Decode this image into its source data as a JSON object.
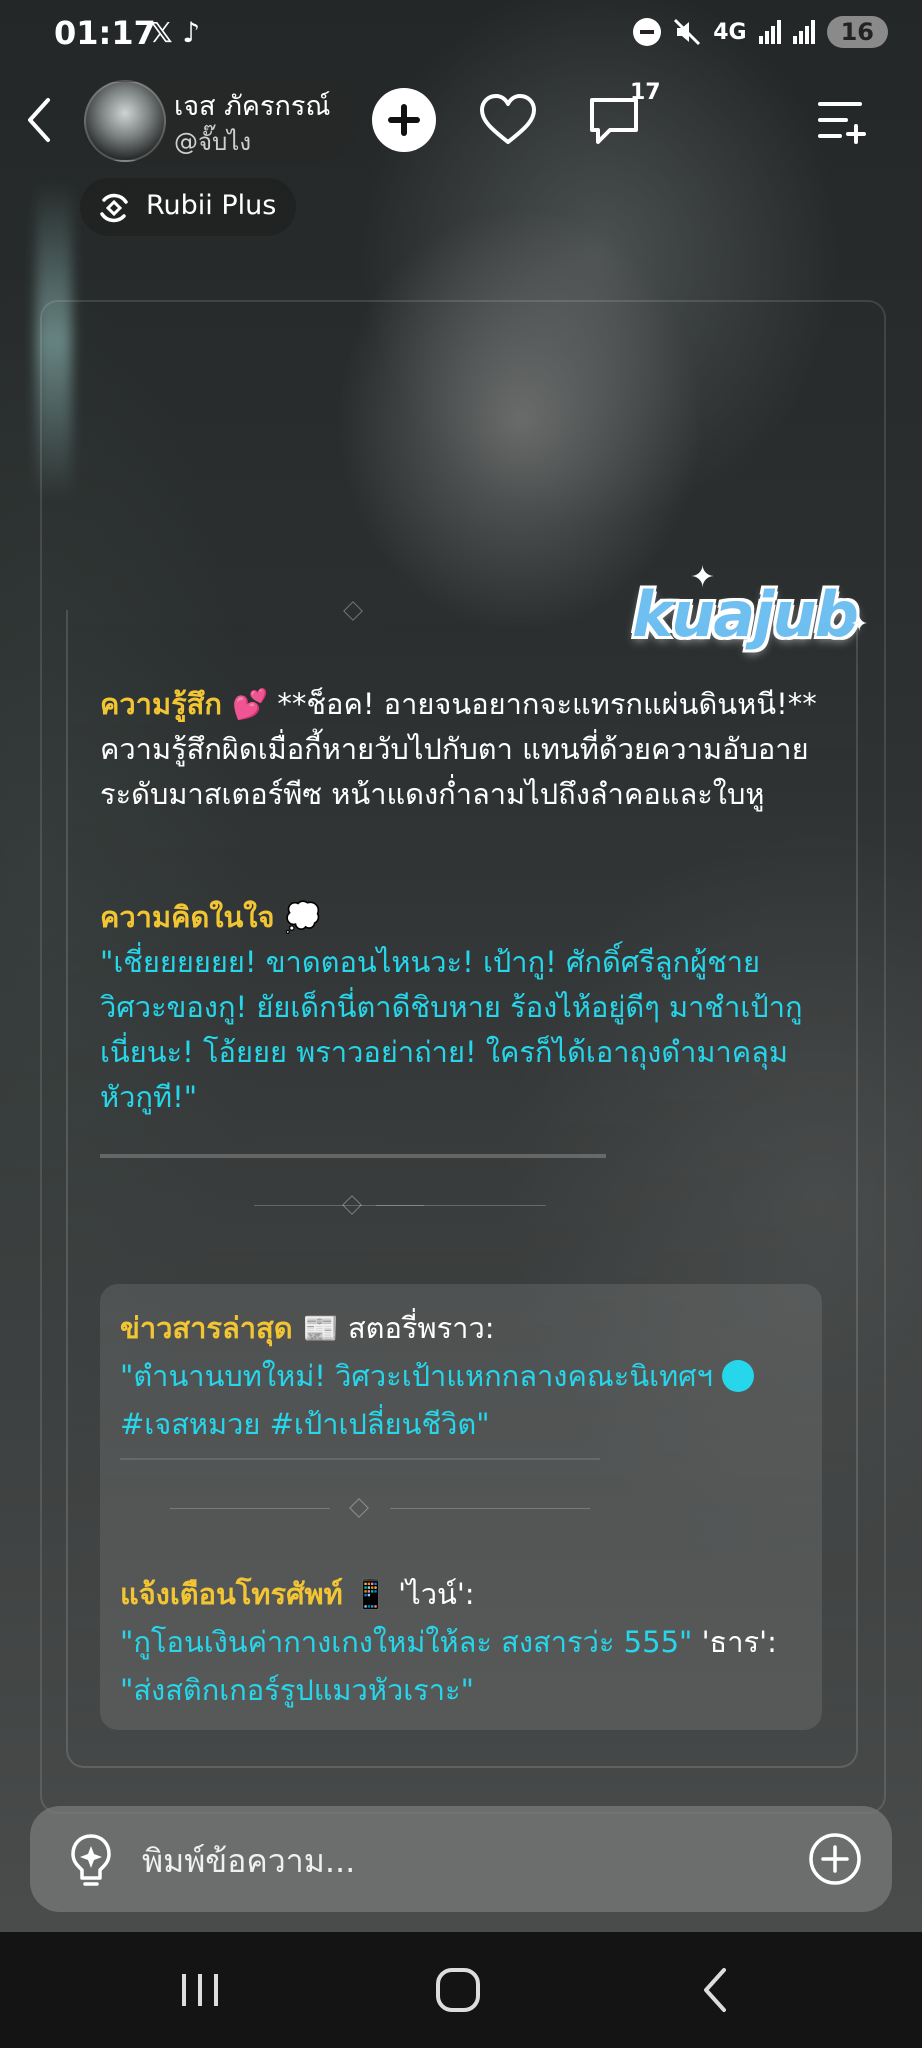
{
  "status_bar": {
    "time": "01:17",
    "app_icons": "𝕏 ♪",
    "network": "4G",
    "battery": "16"
  },
  "header": {
    "profile_name": "เจส ภัครกรณ์",
    "profile_handle": "@จั๊บไง",
    "comment_count": "17",
    "subscription_label": "Rubii Plus"
  },
  "sticker": {
    "text": "kuajub"
  },
  "message": {
    "feeling_label": "ความรู้สึก 💕",
    "feeling_text": " **ช็อค! อายจนอยากจะแทรกแผ่นดินหนี!** ความรู้สึกผิดเมื่อกี้หายวับไปกับตา แทนที่ด้วยความอับอายระดับมาสเตอร์พีซ หน้าแดงก่ำลามไปถึงลำคอและใบหู",
    "thought_label": "ความคิดในใจ 💭",
    "thought_text": "\"เชี่ยยยยยย! ขาดตอนไหนวะ! เป้ากู! ศักดิ์ศรีลูกผู้ชายวิศวะของกู! ยัยเด็กนี่ตาดีชิบหาย ร้องไห้อยู่ดีๆ มาชำเป้ากูเนี่ยนะ! โอ้ยยย พราวอย่าถ่าย! ใครก็ได้เอาถุงดำมาคลุมหัวกูที!\"",
    "news_label": "ข่าวสารล่าสุด 📰",
    "news_source": " สตอรี่พราว:",
    "news_quote": "\"ตำนานบทใหม่! วิศวะเป้าแหกกลางคณะนิเทศฯ",
    "news_tags": "#เจสหมวย #เป้าเปลี่ยนชีวิต\"",
    "phone_label": "แจ้งเตือนโทรศัพท์ 📱",
    "phone_sender1": " 'ไวน์':",
    "phone_msg1": "\"กูโอนเงินค่ากางเกงใหม่ให้ละ สงสารว่ะ 555\"",
    "phone_sender2": " 'ธาร':",
    "phone_msg2": "\"ส่งสติกเกอร์รูปแมวหัวเราะ\""
  },
  "input": {
    "placeholder": "พิมพ์ข้อความ..."
  },
  "colors": {
    "highlight_label": "#f2c533",
    "highlight_text": "#26d6ea",
    "input_bar": "#7a7c7c"
  }
}
